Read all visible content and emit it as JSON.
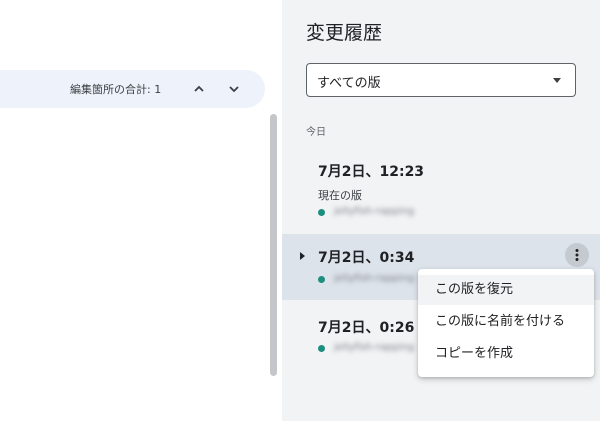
{
  "editor": {
    "edit_count_label": "編集箇所の合計: 1",
    "prev_icon": "chevron-up-icon",
    "next_icon": "chevron-down-icon"
  },
  "history": {
    "title": "変更履歴",
    "filter": {
      "selected": "すべての版"
    },
    "section_label": "今日",
    "versions": [
      {
        "time": "7月2日、12:23",
        "subtitle": "現在の版",
        "author": "jellyfish-rapping",
        "dot_color": "#1e8e7e"
      },
      {
        "time": "7月2日、0:34",
        "author": "jellyfish-rapping",
        "dot_color": "#1e8e7e"
      },
      {
        "time": "7月2日、0:26",
        "author": "jellyfish-rapping",
        "dot_color": "#1e8e7e"
      }
    ]
  },
  "context_menu": {
    "items": [
      {
        "label": "この版を復元"
      },
      {
        "label": "この版に名前を付ける"
      },
      {
        "label": "コピーを作成"
      }
    ]
  },
  "colors": {
    "panel_bg": "#f1f3f4",
    "hover_row_bg": "#dde3ea",
    "edit_bar_bg": "#eef2fa",
    "accent_dot": "#1e8e7e"
  }
}
